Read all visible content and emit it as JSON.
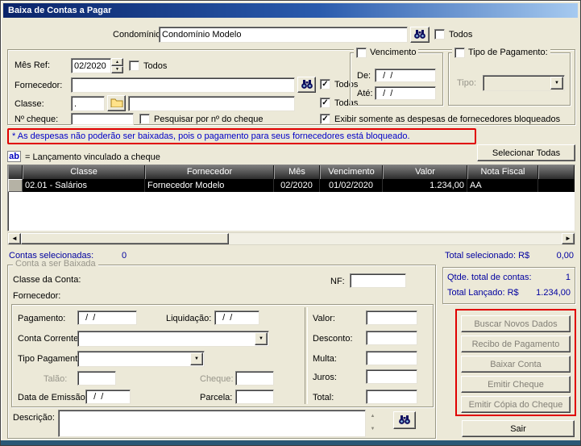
{
  "window": {
    "title": "Baixa de Contas a Pagar"
  },
  "icons": {
    "check": "✓",
    "arrow_up": "▲",
    "arrow_down": "▼",
    "arrow_left": "◄",
    "arrow_right": "►",
    "dropdown": "▼"
  },
  "header": {
    "condominio_label": "Condomínio:",
    "condominio_value": "Condomínio Modelo",
    "todos_label": "Todos"
  },
  "filters": {
    "mes_ref_label": "Mês Ref:",
    "mes_ref_value": "02/2020",
    "mes_todos_label": "Todos",
    "fornecedor_label": "Fornecedor:",
    "fornecedor_value": "",
    "fornecedor_todos_label": "Todos",
    "classe_label": "Classe:",
    "classe_code_value": ".",
    "classe_value": "",
    "classe_todas_label": "Todas",
    "ncheque_label": "Nº cheque:",
    "ncheque_value": "",
    "pesquisar_cheque_label": "Pesquisar por nº do cheque",
    "exibir_bloqueados_label": "Exibir somente as despesas de fornecedores bloqueados",
    "vencimento": {
      "title": "Vencimento",
      "de_label": "De:",
      "de_value": "  /  /",
      "ate_label": "Até:",
      "ate_value": "  /  /"
    },
    "tipo_pagamento": {
      "title": "Tipo de Pagamento:",
      "tipo_label": "Tipo:",
      "tipo_value": ""
    }
  },
  "warning": {
    "text": "* As despesas não poderão ser baixadas, pois o pagamento para seus fornecedores está bloqueado."
  },
  "legend": {
    "icon": "ab",
    "text": "= Lançamento vinculado a cheque"
  },
  "table": {
    "columns": [
      "",
      "Classe",
      "Fornecedor",
      "Mês",
      "Vencimento",
      "Valor",
      "Nota Fiscal",
      ""
    ],
    "rows": [
      {
        "classe": "02.01 - Salários",
        "fornecedor": "Fornecedor Modelo",
        "mes": "02/2020",
        "vencimento": "01/02/2020",
        "valor": "1.234,00",
        "nota_fiscal": "AA"
      }
    ]
  },
  "summary": {
    "contas_label": "Contas selecionadas:",
    "contas_value": "0",
    "total_sel_label": "Total selecionado: R$",
    "total_sel_value": "0,00"
  },
  "conta": {
    "title": "Conta a ser Baixada",
    "classe_conta_label": "Classe da Conta:",
    "nf_label": "NF:",
    "nf_value": "",
    "fornecedor_label": "Fornecedor:",
    "pagamento_label": "Pagamento:",
    "pagamento_value": "  /  /",
    "liquidacao_label": "Liquidação:",
    "liquidacao_value": "  /  /",
    "conta_corrente_label": "Conta Corrente:",
    "conta_corrente_value": "",
    "tipo_pagamento_label": "Tipo Pagamento:",
    "tipo_pagamento_value": "",
    "talao_label": "Talão:",
    "talao_value": "",
    "cheque_label": "Cheque:",
    "cheque_value": "",
    "data_emissao_label": "Data de Emissão:",
    "data_emissao_value": "  /  /",
    "parcela_label": "Parcela:",
    "parcela_value": "",
    "valor_label": "Valor:",
    "desconto_label": "Desconto:",
    "multa_label": "Multa:",
    "juros_label": "Juros:",
    "total_label": "Total:",
    "descricao_label": "Descrição:",
    "descricao_value": ""
  },
  "totals": {
    "qtde_label": "Qtde. total de contas:",
    "qtde_value": "1",
    "lancado_label": "Total Lançado: R$",
    "lancado_value": "1.234,00"
  },
  "actions": {
    "selecionar_todas": "Selecionar Todas",
    "sair": "Sair"
  },
  "action_buttons": [
    "Buscar Novos Dados",
    "Recibo de Pagamento",
    "Baixar Conta",
    "Emitir Cheque",
    "Emitir Cópia do Cheque"
  ],
  "colors": {
    "titlebar_start": "#0a246a",
    "titlebar_end": "#a6caf0",
    "warning_border": "#e00000",
    "info_text": "#0000a0",
    "selected_row_bg": "#000000",
    "header_text": "#ffffff"
  }
}
